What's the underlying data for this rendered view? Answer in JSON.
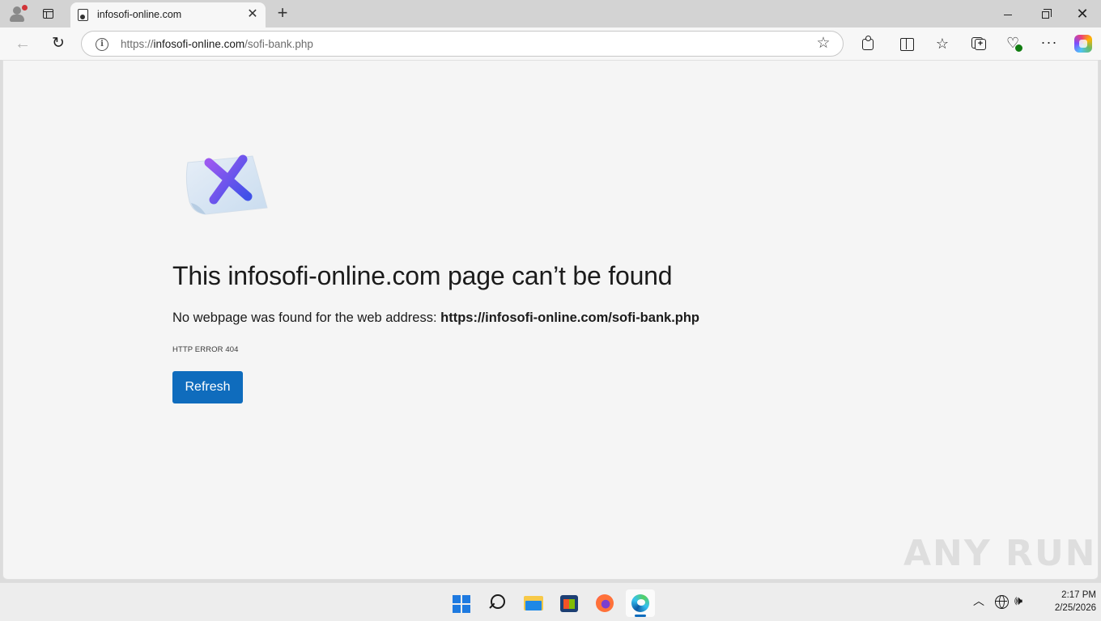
{
  "browser": {
    "tab": {
      "title": "infosofi-online.com"
    },
    "address_bar": {
      "url_scheme": "https://",
      "url_host": "infosofi-online.com",
      "url_path": "/sofi-bank.php"
    }
  },
  "page": {
    "heading": "This infosofi-online.com page can’t be found",
    "description_prefix": "No webpage was found for the web address: ",
    "description_url": "https://infosofi-online.com/sofi-bank.php",
    "error_code": "HTTP ERROR 404",
    "refresh_label": "Refresh"
  },
  "watermark": "ANY  RUN",
  "taskbar": {
    "apps": [
      "start",
      "search",
      "file-explorer",
      "microsoft-store",
      "firefox",
      "edge"
    ],
    "active_app": "edge"
  },
  "tray": {
    "time": "2:17 PM",
    "date": "2/25/2026"
  },
  "colors": {
    "accent": "#0f6cbd",
    "page_background": "#f5f5f5",
    "chrome_background": "#d3d3d3",
    "error_x": "#6a3ff0"
  }
}
